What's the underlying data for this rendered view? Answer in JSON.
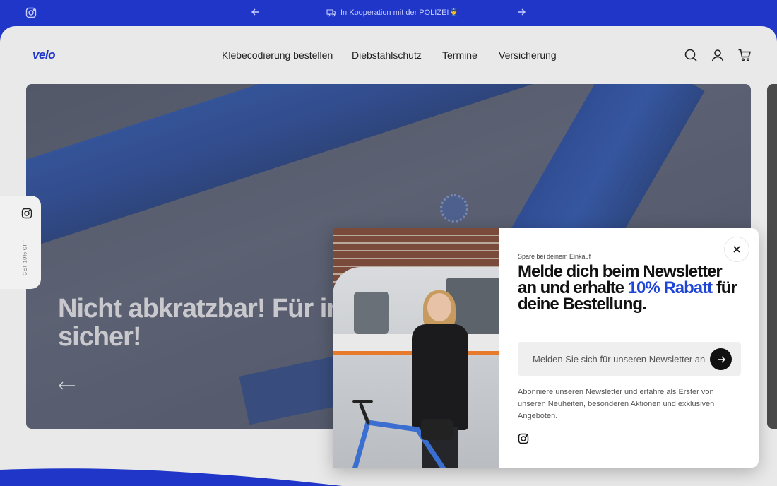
{
  "announcement": {
    "message": "In Kooperation mit der POLIZEI👮"
  },
  "header": {
    "logo": "velo",
    "nav": [
      {
        "label": "Klebecodierung bestellen"
      },
      {
        "label": "Diebstahlschutz"
      },
      {
        "label": "Termine"
      },
      {
        "label": "Versicherung"
      }
    ]
  },
  "hero": {
    "title": "Nicht abkratzbar! Für immer sicher!"
  },
  "side_tab": {
    "label": "GET 10% OFF"
  },
  "popup": {
    "eyebrow": "Spare bei deinem Einkauf",
    "headline_part1": "Melde dich beim Newsletter an und erhalte ",
    "headline_accent": "10% Rabatt",
    "headline_part2": " für deine Bestellung.",
    "email_placeholder": "Melden Sie sich für unseren Newsletter an",
    "description": "Abonniere unseren Newsletter und erfahre als Erster von unseren Neuheiten, besonderen Aktionen und exklusiven Angeboten."
  },
  "colors": {
    "brand_blue": "#1f36c8",
    "accent_blue": "#1f45d6"
  },
  "icons": [
    "instagram-icon",
    "arrow-left-icon",
    "arrow-right-icon",
    "truck-icon",
    "search-icon",
    "account-icon",
    "cart-icon",
    "close-icon",
    "submit-arrow-icon"
  ]
}
